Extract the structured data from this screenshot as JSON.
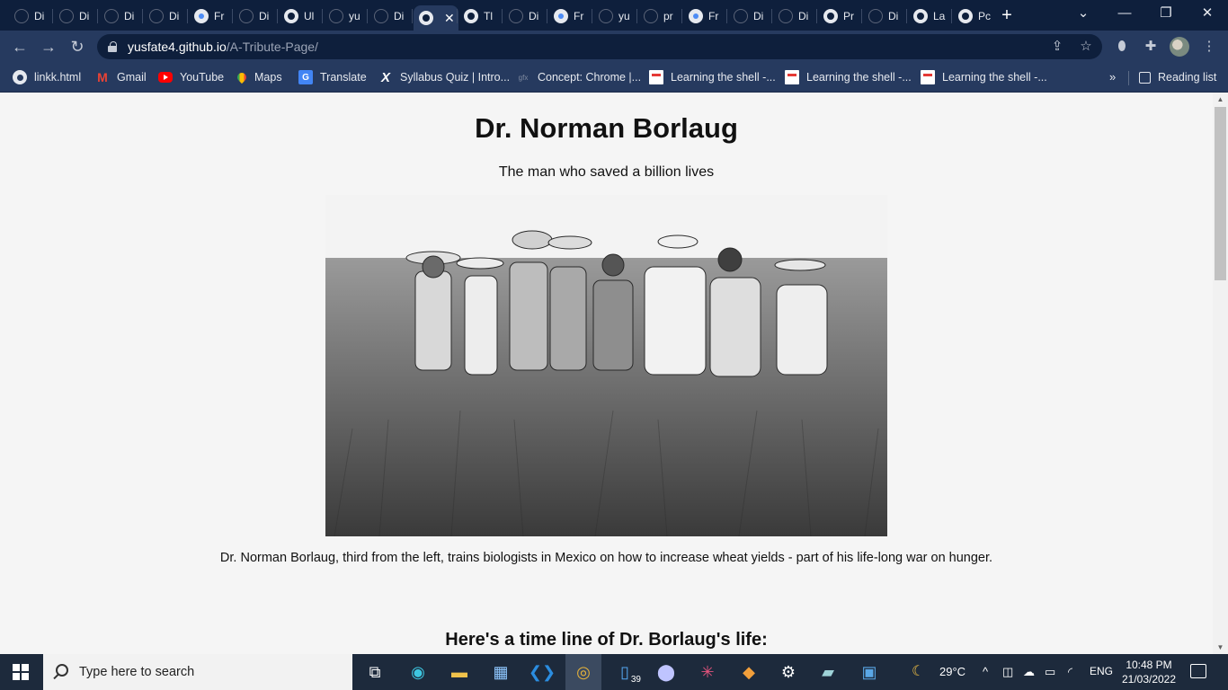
{
  "browser": {
    "tabs": [
      {
        "label": "Di",
        "icon": "github-icon"
      },
      {
        "label": "Di",
        "icon": "github-icon"
      },
      {
        "label": "Di",
        "icon": "github-icon"
      },
      {
        "label": "Di",
        "icon": "github-icon"
      },
      {
        "label": "Fr",
        "icon": "chrome-icon"
      },
      {
        "label": "Di",
        "icon": "github-icon"
      },
      {
        "label": "Ul",
        "icon": "globe-icon"
      },
      {
        "label": "yu",
        "icon": "github-icon"
      },
      {
        "label": "Di",
        "icon": "github-icon"
      },
      {
        "label": "",
        "icon": "globe-icon",
        "active": true
      },
      {
        "label": "Tl",
        "icon": "globe-icon"
      },
      {
        "label": "Di",
        "icon": "github-icon"
      },
      {
        "label": "Fr",
        "icon": "chrome-icon"
      },
      {
        "label": "yu",
        "icon": "github-icon"
      },
      {
        "label": "pr",
        "icon": "github-icon"
      },
      {
        "label": "Fr",
        "icon": "chrome-icon"
      },
      {
        "label": "Di",
        "icon": "github-icon"
      },
      {
        "label": "Di",
        "icon": "github-icon"
      },
      {
        "label": "Pr",
        "icon": "globe-icon"
      },
      {
        "label": "Di",
        "icon": "github-icon"
      },
      {
        "label": "La",
        "icon": "globe-icon"
      },
      {
        "label": "Pc",
        "icon": "globe-icon"
      }
    ],
    "new_tab": "+",
    "window_controls": {
      "chevron": "⌄",
      "minimize": "—",
      "restore": "❐",
      "close": "✕"
    },
    "url_host": "yusfate4.github.io",
    "url_path": "/A-Tribute-Page/",
    "bookmarks": [
      {
        "label": "linkk.html",
        "icon": "globe-icon"
      },
      {
        "label": "Gmail",
        "icon": "gmail-icon"
      },
      {
        "label": "YouTube",
        "icon": "youtube-icon"
      },
      {
        "label": "Maps",
        "icon": "maps-icon"
      },
      {
        "label": "Translate",
        "icon": "translate-icon"
      },
      {
        "label": "Syllabus Quiz | Intro...",
        "icon": "x-icon"
      },
      {
        "label": "Concept: Chrome |...",
        "icon": "concept-icon"
      },
      {
        "label": "Learning the shell -...",
        "icon": "doc-icon"
      },
      {
        "label": "Learning the shell -...",
        "icon": "doc-icon"
      },
      {
        "label": "Learning the shell -...",
        "icon": "doc-icon"
      }
    ],
    "bookmarks_more": "»",
    "reading_list": "Reading list"
  },
  "page": {
    "title": "Dr. Norman Borlaug",
    "subtitle": "The man who saved a billion lives",
    "caption": "Dr. Norman Borlaug, third from the left, trains biologists in Mexico on how to increase wheat yields - part of his life-long war on hunger.",
    "timeline_heading": "Here's a time line of Dr. Borlaug's life:"
  },
  "taskbar": {
    "search_placeholder": "Type here to search",
    "badge_count": "39",
    "weather": "29°C",
    "language": "ENG",
    "time": "10:48 PM",
    "date": "21/03/2022"
  },
  "colors": {
    "tabstrip": "#0e1f3c",
    "toolbar": "#263a5f",
    "page_bg": "#f5f5f5",
    "taskbar": "#1d2a3c"
  }
}
